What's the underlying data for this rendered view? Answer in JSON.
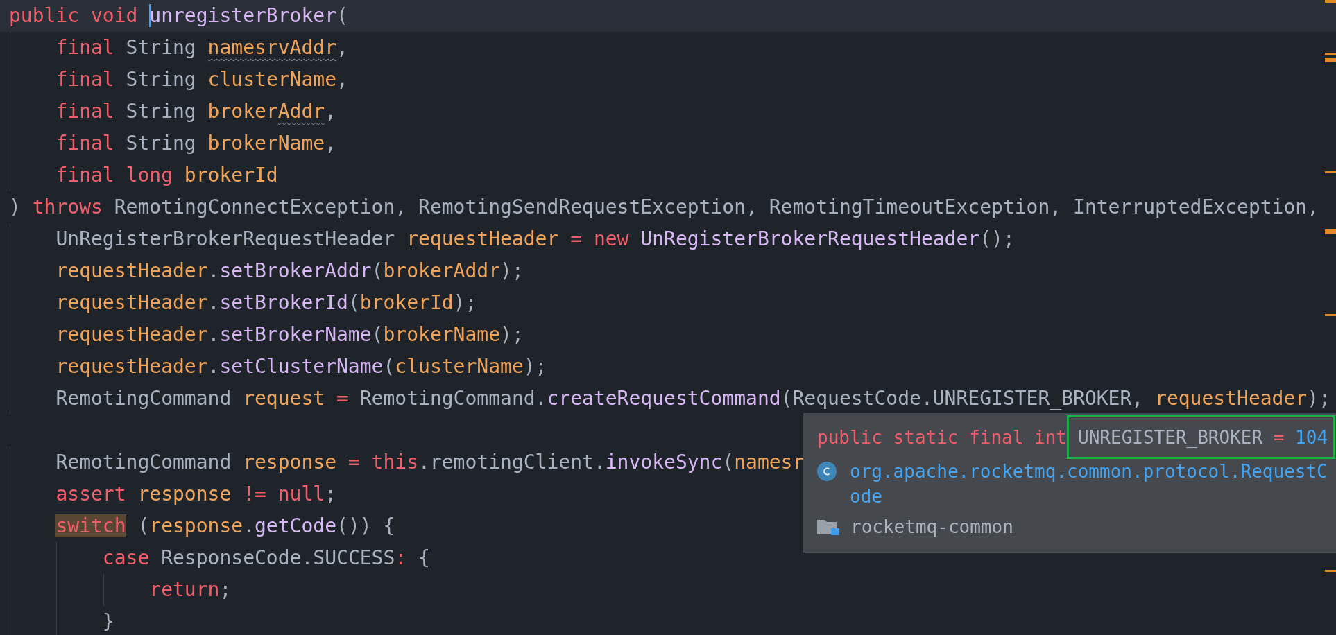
{
  "editor": {
    "lines": [
      {
        "current": true,
        "tokens": [
          {
            "kind": "keyword",
            "text": "public void "
          },
          {
            "kind": "method",
            "text": "unregisterBroker",
            "cursor": true
          },
          {
            "kind": "plain",
            "text": "("
          }
        ]
      },
      {
        "current": false,
        "tokens": [
          {
            "kind": "keyword",
            "text": "    final "
          },
          {
            "kind": "plain",
            "text": "String "
          },
          {
            "kind": "variable",
            "text": "namesrvAddr",
            "warning": true
          },
          {
            "kind": "plain",
            "text": ","
          }
        ]
      },
      {
        "current": false,
        "tokens": [
          {
            "kind": "keyword",
            "text": "    final "
          },
          {
            "kind": "plain",
            "text": "String "
          },
          {
            "kind": "variable",
            "text": "clusterName"
          },
          {
            "kind": "plain",
            "text": ","
          }
        ]
      },
      {
        "current": false,
        "tokens": [
          {
            "kind": "keyword",
            "text": "    final "
          },
          {
            "kind": "plain",
            "text": "String "
          },
          {
            "kind": "variable",
            "text": "broker"
          },
          {
            "kind": "variable",
            "text": "Addr",
            "warning": true
          },
          {
            "kind": "plain",
            "text": ","
          }
        ]
      },
      {
        "current": false,
        "tokens": [
          {
            "kind": "keyword",
            "text": "    final "
          },
          {
            "kind": "plain",
            "text": "String "
          },
          {
            "kind": "variable",
            "text": "brokerName"
          },
          {
            "kind": "plain",
            "text": ","
          }
        ]
      },
      {
        "current": false,
        "tokens": [
          {
            "kind": "keyword",
            "text": "    final long "
          },
          {
            "kind": "variable",
            "text": "brokerId"
          }
        ]
      },
      {
        "current": false,
        "tokens": [
          {
            "kind": "plain",
            "text": ") "
          },
          {
            "kind": "keyword",
            "text": "throws "
          },
          {
            "kind": "plain",
            "text": "RemotingConnectException, RemotingSendRequestException, RemotingTimeoutException, InterruptedException,"
          }
        ]
      },
      {
        "current": false,
        "tokens": [
          {
            "kind": "plain",
            "text": "    UnRegisterBrokerRequestHeader "
          },
          {
            "kind": "variable",
            "text": "requestHeader"
          },
          {
            "kind": "keyword",
            "text": " = new "
          },
          {
            "kind": "method",
            "text": "UnRegisterBrokerRequestHeader"
          },
          {
            "kind": "plain",
            "text": "();"
          }
        ]
      },
      {
        "current": false,
        "tokens": [
          {
            "kind": "variable",
            "text": "    requestHeader"
          },
          {
            "kind": "plain",
            "text": "."
          },
          {
            "kind": "method",
            "text": "setBrokerAddr"
          },
          {
            "kind": "plain",
            "text": "("
          },
          {
            "kind": "variable",
            "text": "brokerAddr"
          },
          {
            "kind": "plain",
            "text": ");"
          }
        ]
      },
      {
        "current": false,
        "tokens": [
          {
            "kind": "variable",
            "text": "    requestHeader"
          },
          {
            "kind": "plain",
            "text": "."
          },
          {
            "kind": "method",
            "text": "setBrokerId"
          },
          {
            "kind": "plain",
            "text": "("
          },
          {
            "kind": "variable",
            "text": "brokerId"
          },
          {
            "kind": "plain",
            "text": ");"
          }
        ]
      },
      {
        "current": false,
        "tokens": [
          {
            "kind": "variable",
            "text": "    requestHeader"
          },
          {
            "kind": "plain",
            "text": "."
          },
          {
            "kind": "method",
            "text": "setBrokerName"
          },
          {
            "kind": "plain",
            "text": "("
          },
          {
            "kind": "variable",
            "text": "brokerName"
          },
          {
            "kind": "plain",
            "text": ");"
          }
        ]
      },
      {
        "current": false,
        "tokens": [
          {
            "kind": "variable",
            "text": "    requestHeader"
          },
          {
            "kind": "plain",
            "text": "."
          },
          {
            "kind": "method",
            "text": "setClusterName"
          },
          {
            "kind": "plain",
            "text": "("
          },
          {
            "kind": "variable",
            "text": "clusterName"
          },
          {
            "kind": "plain",
            "text": ");"
          }
        ]
      },
      {
        "current": false,
        "tokens": [
          {
            "kind": "plain",
            "text": "    RemotingCommand "
          },
          {
            "kind": "variable",
            "text": "request"
          },
          {
            "kind": "keyword",
            "text": " = "
          },
          {
            "kind": "plain",
            "text": "RemotingCommand."
          },
          {
            "kind": "method",
            "text": "createRequestCommand"
          },
          {
            "kind": "plain",
            "text": "(RequestCode.UNREGISTER_BROKER, "
          },
          {
            "kind": "variable",
            "text": "requestHeader"
          },
          {
            "kind": "plain",
            "text": ");"
          }
        ]
      },
      {
        "current": false
      },
      {
        "current": false,
        "tokens": [
          {
            "kind": "plain",
            "text": "    RemotingCommand "
          },
          {
            "kind": "variable",
            "text": "response"
          },
          {
            "kind": "keyword",
            "text": " = this"
          },
          {
            "kind": "plain",
            "text": ".remotingClient."
          },
          {
            "kind": "method",
            "text": "invokeSync"
          },
          {
            "kind": "plain",
            "text": "("
          },
          {
            "kind": "variable",
            "text": "namesr"
          }
        ]
      },
      {
        "current": false,
        "tokens": [
          {
            "kind": "keyword",
            "text": "    assert "
          },
          {
            "kind": "variable",
            "text": "response"
          },
          {
            "kind": "keyword",
            "text": " != null"
          },
          {
            "kind": "plain",
            "text": ";"
          }
        ]
      },
      {
        "current": false,
        "tokens": [
          {
            "kind": "keyword",
            "text": "    switch",
            "highlighted": true
          },
          {
            "kind": "plain",
            "text": " ("
          },
          {
            "kind": "variable",
            "text": "response"
          },
          {
            "kind": "plain",
            "text": "."
          },
          {
            "kind": "method",
            "text": "getCode"
          },
          {
            "kind": "plain",
            "text": "()) {"
          }
        ]
      },
      {
        "current": false,
        "tokens": [
          {
            "kind": "keyword",
            "text": "        case "
          },
          {
            "kind": "plain",
            "text": "ResponseCode.SUCCESS"
          },
          {
            "kind": "keyword",
            "text": ":"
          },
          {
            "kind": "plain",
            "text": " {"
          }
        ]
      },
      {
        "current": false,
        "tokens": [
          {
            "kind": "keyword",
            "text": "            return"
          },
          {
            "kind": "plain",
            "text": ";"
          }
        ]
      },
      {
        "current": false,
        "tokens": [
          {
            "kind": "plain",
            "text": "        }"
          }
        ]
      }
    ]
  },
  "quick_doc": {
    "modifiers": "public static final int",
    "declaration": [
      {
        "kind": "plain",
        "text": "UNREGISTER_BROKER"
      },
      {
        "kind": "keyword",
        "text": " = "
      },
      {
        "kind": "number",
        "text": "104"
      }
    ],
    "class_path": "org.apache.rocketmq.common.protocol.RequestCode",
    "module": "rocketmq-common"
  }
}
